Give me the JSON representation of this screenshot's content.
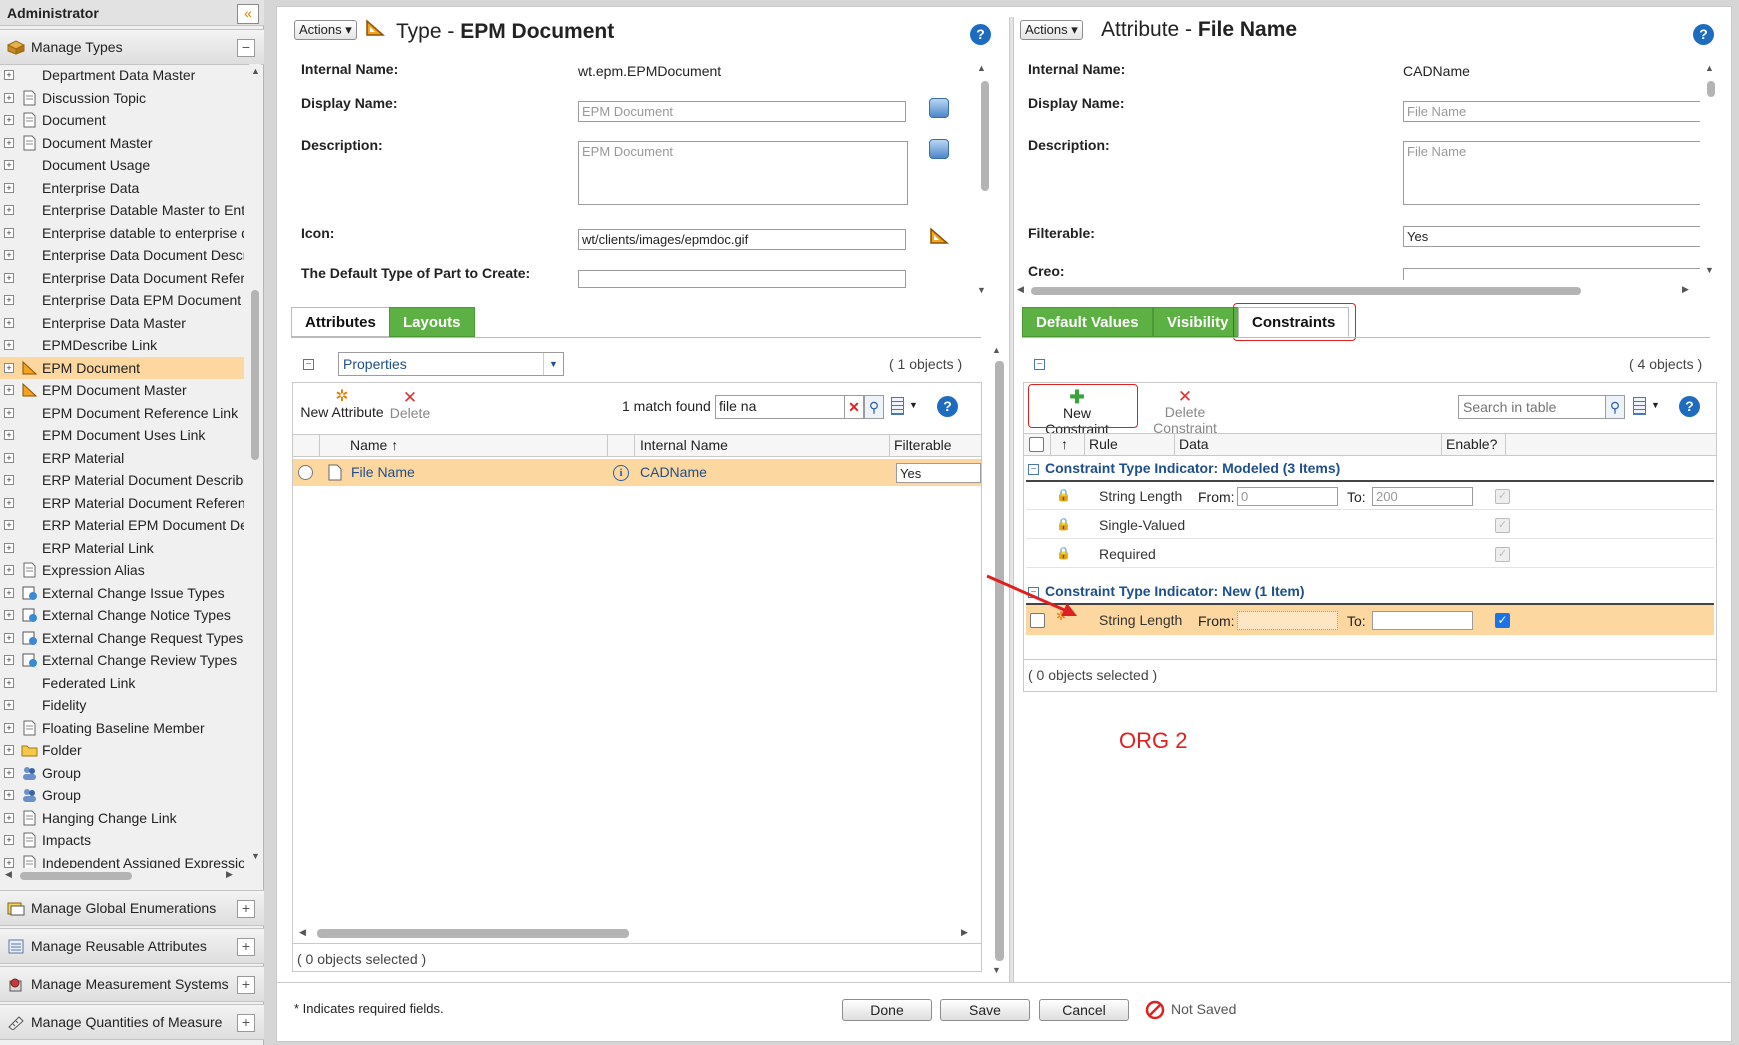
{
  "sidebar": {
    "title": "Administrator",
    "collapse_icon": "«",
    "manage_types": "Manage Types",
    "tree_items": [
      "Department Data Master",
      "Discussion Topic",
      "Document",
      "Document Master",
      "Document Usage",
      "Enterprise Data",
      "Enterprise Datable Master to Ente",
      "Enterprise datable to enterprise d",
      "Enterprise Data Document Descr",
      "Enterprise Data Document Refer",
      "Enterprise Data EPM Document I",
      "Enterprise Data Master",
      "EPMDescribe Link",
      "EPM Document",
      "EPM Document Master",
      "EPM Document Reference Link",
      "EPM Document Uses Link",
      "ERP Material",
      "ERP Material Document Describe",
      "ERP Material Document Referen",
      "ERP Material EPM Document De",
      "ERP Material Link",
      "Expression Alias",
      "External Change Issue Types",
      "External Change Notice Types",
      "External Change Request Types",
      "External Change Review Types",
      "Federated Link",
      "Fidelity",
      "Floating Baseline Member",
      "Folder",
      "Group",
      "Group",
      "Hanging Change Link",
      "Impacts",
      "Independent Assigned Expressio"
    ],
    "selected_item": "EPM Document",
    "accordions": [
      "Manage Global Enumerations",
      "Manage Reusable Attributes",
      "Manage Measurement Systems",
      "Manage Quantities of Measure"
    ]
  },
  "left_panel": {
    "actions_label": "Actions",
    "title_prefix": "Type - ",
    "title_bold": "EPM Document",
    "props": {
      "internal_name_label": "Internal Name:",
      "internal_name_value": "wt.epm.EPMDocument",
      "display_name_label": "Display Name:",
      "display_name_value": "EPM Document",
      "description_label": "Description:",
      "description_value": "EPM Document",
      "icon_label": "Icon:",
      "icon_value": "wt/clients/images/epmdoc.gif",
      "default_part_label": "The Default Type of Part to Create:",
      "default_part_value": ""
    },
    "tabs": [
      "Attributes",
      "Layouts"
    ],
    "view_select": "Properties",
    "objects_count": "( 1 objects )",
    "toolbar": {
      "new_attribute": "New Attribute",
      "delete": "Delete",
      "match_found": "1 match found",
      "search_value": "file na"
    },
    "columns": [
      "Name",
      "Internal Name",
      "Filterable"
    ],
    "sort_arrow": "↑",
    "rows": [
      {
        "name": "File Name",
        "internal": "CADName",
        "filterable": "Yes"
      }
    ],
    "footer": "( 0 objects selected )"
  },
  "right_panel": {
    "actions_label": "Actions",
    "title_prefix": "Attribute - ",
    "title_bold": "File Name",
    "props": {
      "internal_name_label": "Internal Name:",
      "internal_name_value": "CADName",
      "display_name_label": "Display Name:",
      "display_name_value": "File Name",
      "description_label": "Description:",
      "description_value": "File Name",
      "filterable_label": "Filterable:",
      "filterable_value": "Yes",
      "creo_label": "Creo:"
    },
    "tabs": [
      "Default Values",
      "Visibility",
      "Constraints"
    ],
    "objects_count": "( 4 objects )",
    "toolbar": {
      "new_constraint": "New Constraint",
      "delete_constraint": "Delete Constraint",
      "search_placeholder": "Search in table"
    },
    "columns": [
      "↑",
      "Rule",
      "Data",
      "Enable?"
    ],
    "group_modeled": "Constraint Type Indicator: Modeled (3 Items)",
    "group_new": "Constraint Type Indicator: New (1 Item)",
    "modeled_rows": [
      {
        "rule": "String Length",
        "from_label": "From:",
        "from": "0",
        "to_label": "To:",
        "to": "200"
      },
      {
        "rule": "Single-Valued"
      },
      {
        "rule": "Required"
      }
    ],
    "new_rows": [
      {
        "rule": "String Length",
        "from_label": "From:",
        "from": "",
        "to_label": "To:",
        "to": ""
      }
    ],
    "footer": "( 0 objects selected )",
    "annotation": "ORG 2"
  },
  "bottom": {
    "required_note": "* Indicates required fields.",
    "done": "Done",
    "save": "Save",
    "cancel": "Cancel",
    "status": "Not Saved"
  },
  "colors": {
    "accent_green": "#5db043",
    "selected_row": "#fcd7a0",
    "annotation_red": "#e02020",
    "help_blue": "#1e6cbf"
  }
}
